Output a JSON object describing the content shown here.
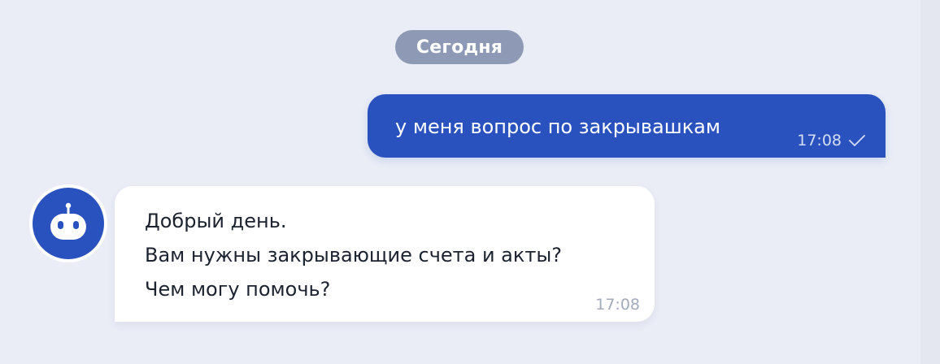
{
  "chat": {
    "date_separator": "Сегодня",
    "messages": [
      {
        "direction": "outgoing",
        "text": "у меня вопрос по закрывашкам",
        "time": "17:08",
        "status_icon": "check-icon"
      },
      {
        "direction": "incoming",
        "sender_icon": "robot-icon",
        "lines": [
          "Добрый день.",
          "Вам нужны закрывающие счета и акты?",
          "Чем могу помочь?"
        ],
        "time": "17:08"
      }
    ]
  },
  "colors": {
    "background": "#eaedf6",
    "outgoing_bubble": "#2a52be",
    "incoming_bubble": "#ffffff",
    "date_chip": "#8e9ab5",
    "avatar": "#2a52be"
  }
}
